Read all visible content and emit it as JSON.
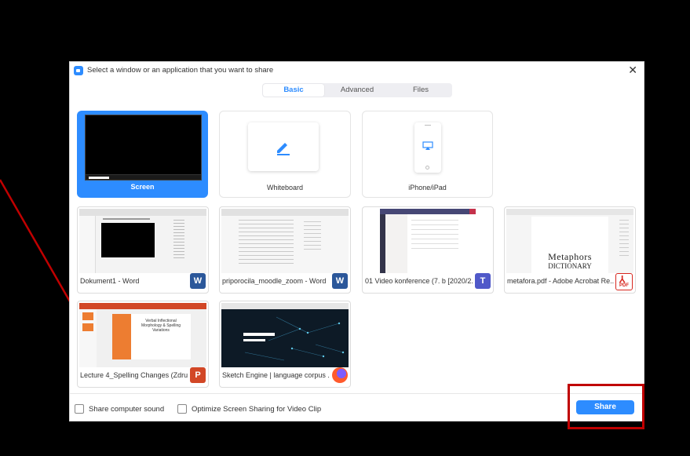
{
  "title": "Select a window or an application that you want to share",
  "tabs": [
    {
      "label": "Basic",
      "active": true
    },
    {
      "label": "Advanced",
      "active": false
    },
    {
      "label": "Files",
      "active": false
    }
  ],
  "tiles": {
    "screen": "Screen",
    "whiteboard": "Whiteboard",
    "iphone": "iPhone/iPad"
  },
  "windows": [
    {
      "label": "Dokument1 - Word",
      "app": "word-icon",
      "badge": "W"
    },
    {
      "label": "priporocila_moodle_zoom - Word",
      "app": "word-icon",
      "badge": "W"
    },
    {
      "label": "01 Video konference (7. b [2020/2...",
      "app": "teams-icon",
      "badge": "T"
    },
    {
      "label": "metafora.pdf - Adobe Acrobat Re...",
      "app": "acrobat-icon",
      "badge": "PDF"
    },
    {
      "label": "Lecture 4_Spelling Changes (Zdru...",
      "app": "powerpoint-icon",
      "badge": "P"
    },
    {
      "label": "Sketch Engine | language corpus ...",
      "app": "firefox-icon",
      "badge": ""
    }
  ],
  "thumb_text": {
    "metaphors_line1": "Metaphors",
    "metaphors_line2": "DICTIONARY",
    "lecture_title": "Verbal Inflectional Morphology & Spelling Variations"
  },
  "footer": {
    "share_sound": "Share computer sound",
    "optimize": "Optimize Screen Sharing for Video Clip",
    "share_button": "Share"
  },
  "colors": {
    "accent": "#2d8cff",
    "word": "#2b579a",
    "teams": "#5059c9",
    "acrobat": "#d7261e",
    "powerpoint": "#d24726",
    "annotation": "#c00000"
  }
}
